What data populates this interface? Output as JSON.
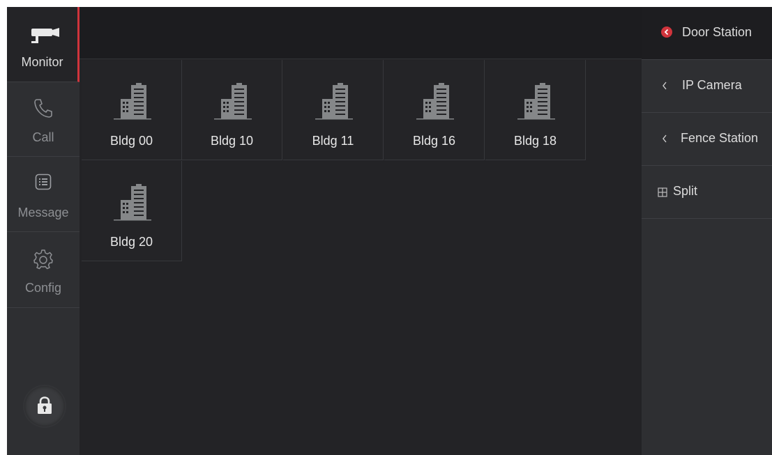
{
  "nav": {
    "items": [
      {
        "label": "Monitor",
        "icon": "camera-icon",
        "active": true
      },
      {
        "label": "Call",
        "icon": "phone-icon",
        "active": false
      },
      {
        "label": "Message",
        "icon": "message-icon",
        "active": false
      },
      {
        "label": "Config",
        "icon": "gear-icon",
        "active": false
      }
    ],
    "lock_icon": "lock-icon"
  },
  "buildings": [
    {
      "label": "Bldg 00",
      "icon": "building-icon"
    },
    {
      "label": "Bldg 10",
      "icon": "building-icon"
    },
    {
      "label": "Bldg 11",
      "icon": "building-icon"
    },
    {
      "label": "Bldg 16",
      "icon": "building-icon"
    },
    {
      "label": "Bldg 18",
      "icon": "building-icon"
    },
    {
      "label": "Bldg 20",
      "icon": "building-icon"
    }
  ],
  "right_panel": {
    "items": [
      {
        "label": "Door Station",
        "icon": "chevron-left-circle-icon",
        "active": true
      },
      {
        "label": "IP Camera",
        "icon": "chevron-left-icon",
        "active": false
      },
      {
        "label": "Fence Station",
        "icon": "chevron-left-icon",
        "active": false
      },
      {
        "label": "Split",
        "icon": "grid-split-icon",
        "active": false
      }
    ]
  },
  "colors": {
    "accent": "#d0343c",
    "background": "#232326",
    "panel": "#2e2f32"
  }
}
